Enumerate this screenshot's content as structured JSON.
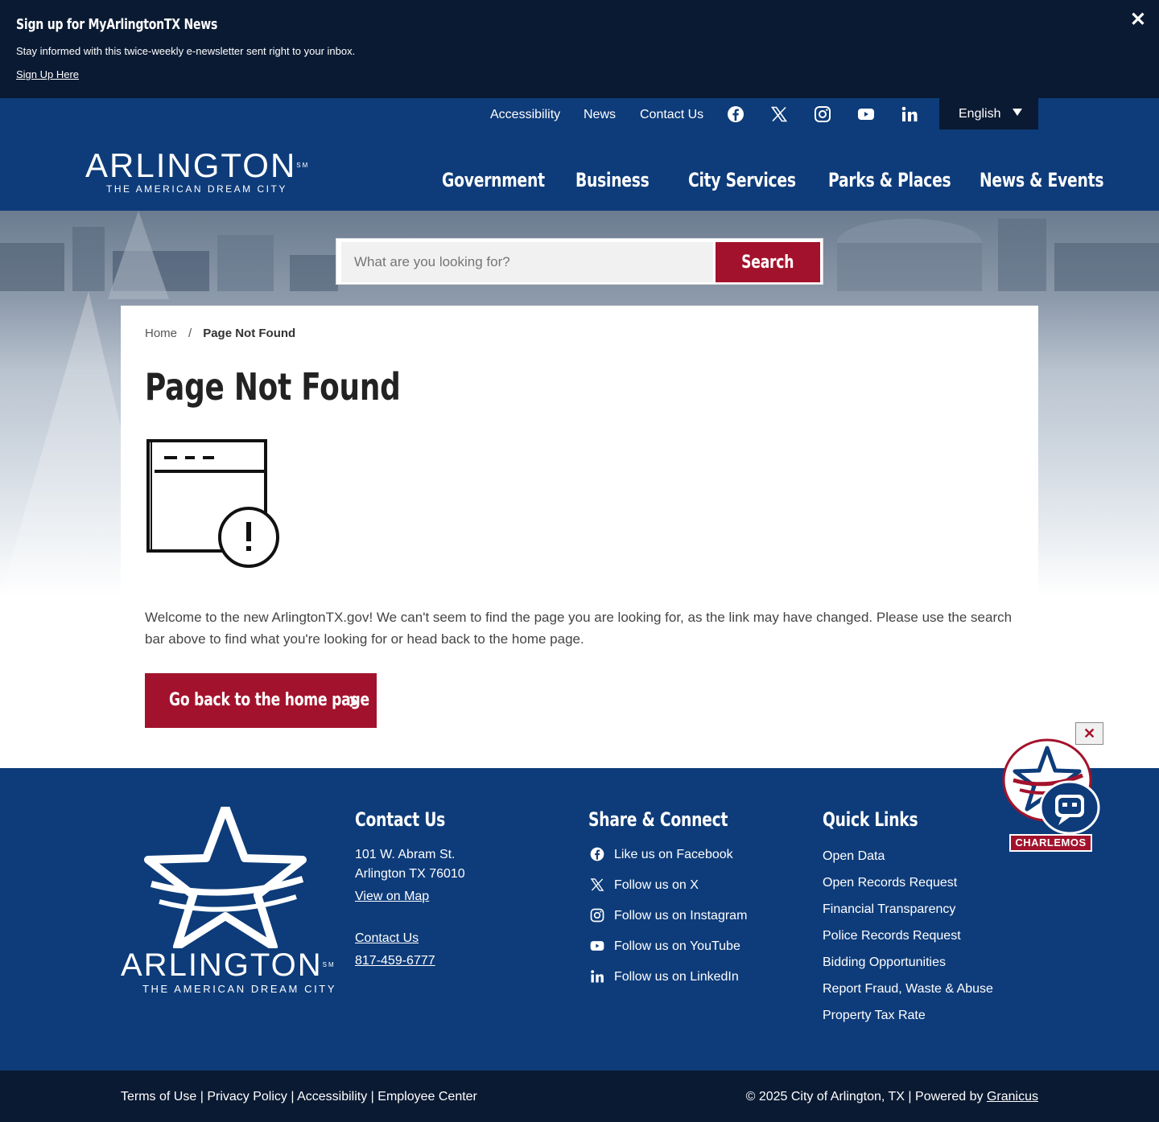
{
  "banner": {
    "title": "Sign up for MyArlingtonTX News",
    "description": "Stay informed with this twice-weekly e-newsletter sent right to your inbox.",
    "link": "Sign Up Here",
    "close": "✕"
  },
  "header": {
    "utility_links": [
      "Accessibility",
      "News",
      "Contact Us"
    ],
    "social_icons": [
      "facebook-icon",
      "x-icon",
      "instagram-icon",
      "youtube-icon",
      "linkedin-icon"
    ],
    "language": "English",
    "logo": {
      "name": "ARLINGTON",
      "mark": "SM",
      "tagline": "THE AMERICAN DREAM CITY"
    },
    "nav": [
      "Government",
      "Business",
      "City Services",
      "Parks & Places",
      "News & Events"
    ]
  },
  "search": {
    "placeholder": "What are you looking for?",
    "button": "Search"
  },
  "content": {
    "breadcrumb": {
      "home": "Home",
      "separator": "/",
      "current": "Page Not Found"
    },
    "title": "Page Not Found",
    "illustration_icon": "browser-error-icon",
    "message": "Welcome to the new ArlingtonTX.gov! We can't seem to find the page you are looking for, as the link may have changed. Please use the search bar above to find what you're looking for or head back to the home page.",
    "home_button": "Go back to the home page"
  },
  "chat": {
    "close": "✕",
    "label": "CHARLEMOS"
  },
  "footer": {
    "logo": {
      "name": "ARLINGTON",
      "mark": "SM",
      "tagline": "THE AMERICAN DREAM CITY"
    },
    "contact": {
      "title": "Contact Us",
      "address1": "101 W. Abram St.",
      "address2": "Arlington TX 76010",
      "map_link": "View on Map",
      "contact_link": "Contact Us",
      "phone": "817-459-6777"
    },
    "share": {
      "title": "Share & Connect",
      "items": [
        "Like us on Facebook",
        "Follow us on X",
        "Follow us on Instagram",
        "Follow us on YouTube",
        "Follow us on LinkedIn"
      ]
    },
    "quick": {
      "title": "Quick Links",
      "items": [
        "Open Data",
        "Open Records Request",
        "Financial Transparency",
        "Police Records Request",
        "Bidding Opportunities",
        "Report Fraud, Waste & Abuse",
        "Property Tax Rate"
      ]
    }
  },
  "subfooter": {
    "links": [
      "Terms of Use",
      "Privacy Policy",
      "Accessibility",
      "Employee Center"
    ],
    "separator": "|",
    "copyright": "© 2025 City of Arlington, TX | Powered by",
    "powered_by": "Granicus"
  },
  "colors": {
    "navy": "#0e3c7a",
    "dark_navy": "#0a1a33",
    "brand_red": "#a3122c"
  }
}
